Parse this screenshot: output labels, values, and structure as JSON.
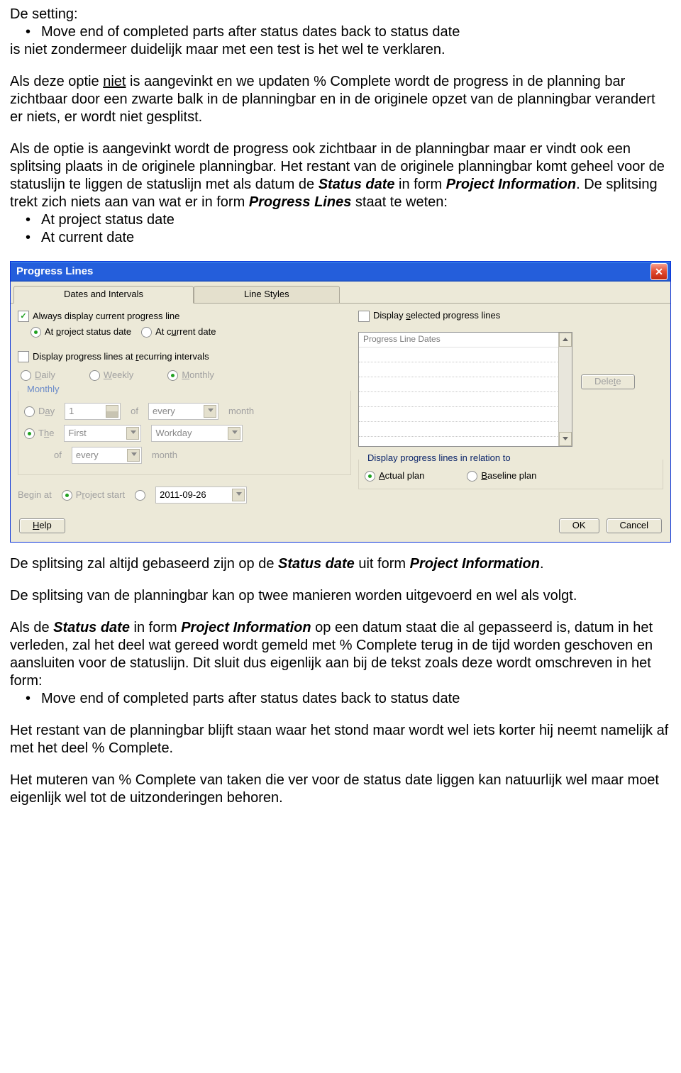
{
  "text": {
    "p1_l1": "De setting:",
    "p1_bullet": "Move end of completed parts after status dates back to status date",
    "p1_l3": "is niet zondermeer duidelijk maar met een test is het wel te verklaren.",
    "p2_a": "Als deze optie ",
    "p2_niet": "niet",
    "p2_b": " is aangevinkt en we updaten % Complete wordt de progress in de planning bar zichtbaar door een zwarte balk in de planningbar en in de originele opzet van de planningbar verandert er niets, er wordt niet gesplitst.",
    "p3_a": "Als de optie is aangevinkt wordt de progress ook zichtbaar in de planningbar maar er vindt ook een splitsing plaats in de originele planningbar. Het restant van de originele planningbar komt geheel voor de statuslijn te liggen de statuslijn met als datum de ",
    "p3_sd": "Status date",
    "p3_b": " in form ",
    "p3_pi": "Project Information",
    "p3_c": ". De splitsing trekt zich niets aan van wat er in form  ",
    "p3_pl": "Progress Lines",
    "p3_d": "  staat te weten:",
    "p3_bul1": "At project status date",
    "p3_bul2": "At current date",
    "p4_a": "De splitsing zal altijd gebaseerd zijn op de ",
    "p4_sd": "Status date",
    "p4_b": " uit form ",
    "p4_pi": "Project Information",
    "p4_c": ".",
    "p5": "De splitsing van de planningbar kan op twee manieren worden uitgevoerd en wel als volgt.",
    "p6_a": "Als de ",
    "p6_sd": "Status date",
    "p6_b": " in form ",
    "p6_pi": "Project Information",
    "p6_c": " op een datum staat die al gepasseerd is, datum in het verleden, zal het deel wat gereed wordt gemeld met % Complete terug in de tijd worden geschoven en aansluiten voor de statuslijn. Dit sluit dus eigenlijk aan bij de tekst zoals deze wordt omschreven in het form:",
    "p6_bul": "Move end of completed parts after status dates back to status date",
    "p7": "Het restant van de planningbar blijft staan waar het stond maar wordt wel iets korter hij neemt namelijk af met het deel % Complete.",
    "p8": "Het muteren van % Complete van taken die ver voor de status date liggen kan natuurlijk wel maar moet eigenlijk wel tot de uitzonderingen behoren."
  },
  "dialog": {
    "title": "Progress Lines",
    "tabs": {
      "t1": "Dates and Intervals",
      "t2": "Line Styles"
    },
    "left": {
      "always": "Always display current progress line",
      "r_status_pre": "At ",
      "r_status_acc": "p",
      "r_status_post": "roject status date",
      "r_current_pre": "At c",
      "r_current_acc": "u",
      "r_current_post": "rrent date",
      "recurring_pre": "Display progress lines at ",
      "recurring_acc": "r",
      "recurring_post": "ecurring intervals",
      "daily_acc": "D",
      "daily_post": "aily",
      "weekly_acc": "W",
      "weekly_post": "eekly",
      "monthly_acc": "M",
      "monthly_post": "onthly",
      "monthly_group": "Monthly",
      "day_pre": "D",
      "day_acc": "a",
      "day_post": "y",
      "day_val": "1",
      "of": "of",
      "every_val": "every",
      "month": "month",
      "the_pre": "T",
      "the_acc": "h",
      "the_post": "e",
      "first_val": "First",
      "workday_val": "Workday",
      "of2": "of",
      "every2": "every",
      "month2": "month",
      "begin_pre": "Be",
      "begin_acc": "g",
      "begin_post": "in at",
      "ps_pre": "P",
      "ps_acc": "r",
      "ps_post": "oject start",
      "date_val": "2011-09-26"
    },
    "right": {
      "selected_pre": "Display ",
      "selected_acc": "s",
      "selected_post": "elected progress lines",
      "listcap": "Progress Line Dates",
      "delete_pre": "Dele",
      "delete_acc": "t",
      "delete_post": "e",
      "relation": "Display progress lines in relation to",
      "actual_acc": "A",
      "actual_post": "ctual plan",
      "baseline_acc": "B",
      "baseline_post": "aseline plan"
    },
    "footer": {
      "help_acc": "H",
      "help_post": "elp",
      "ok": "OK",
      "cancel": "Cancel"
    }
  }
}
